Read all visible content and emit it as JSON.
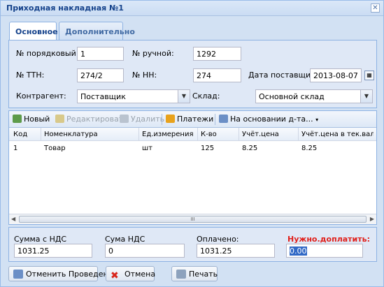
{
  "window": {
    "title": "Приходная накладная №1"
  },
  "tabs": [
    {
      "label": "Основное"
    },
    {
      "label": "Дополнительно"
    }
  ],
  "form": {
    "order_no_label": "№ порядковый:",
    "order_no_value": "1",
    "manual_no_label": "№ ручной:",
    "manual_no_value": "1292",
    "ttn_label": "№ ТТН:",
    "ttn_value": "274/2",
    "nn_label": "№ НН:",
    "nn_value": "274",
    "supply_date_label": "Дата поставщика:",
    "supply_date_value": "2013-08-07",
    "counterparty_label": "Контрагент:",
    "counterparty_value": "Поставщик",
    "warehouse_label": "Склад:",
    "warehouse_value": "Основной склад"
  },
  "toolbar": {
    "new": "Новый",
    "edit": "Редактировать",
    "delete": "Удалить",
    "payments": "Платежи",
    "based_on": "На основании д-та...",
    "based_on_arrow": "▾"
  },
  "grid": {
    "columns": [
      "Код",
      "Номенклатура",
      "Ед.измерения",
      "К-во",
      "Учёт.цена",
      "Учёт.цена в тек.вал."
    ],
    "rows": [
      {
        "code": "1",
        "name": "Товар",
        "unit": "шт",
        "qty": "125",
        "price": "8.25",
        "price_cur": "8.25"
      }
    ],
    "scroll_grip": "III",
    "scroll_left": "◀",
    "scroll_right": "▶"
  },
  "totals": {
    "sum_vat_label": "Сумма с НДС",
    "sum_vat_value": "1031.25",
    "vat_label": "Сума НДС",
    "vat_value": "0",
    "paid_label": "Оплачено:",
    "paid_value": "1031.25",
    "due_label": "Нужно.доплатить:",
    "due_value": "0.00"
  },
  "footer": {
    "cancel_posting": "Отменить Проведение",
    "cancel": "Отмена",
    "print": "Печать"
  },
  "colors": {
    "accent": "#15428b",
    "due_label": "#e0201b",
    "selection": "#3169c6"
  }
}
